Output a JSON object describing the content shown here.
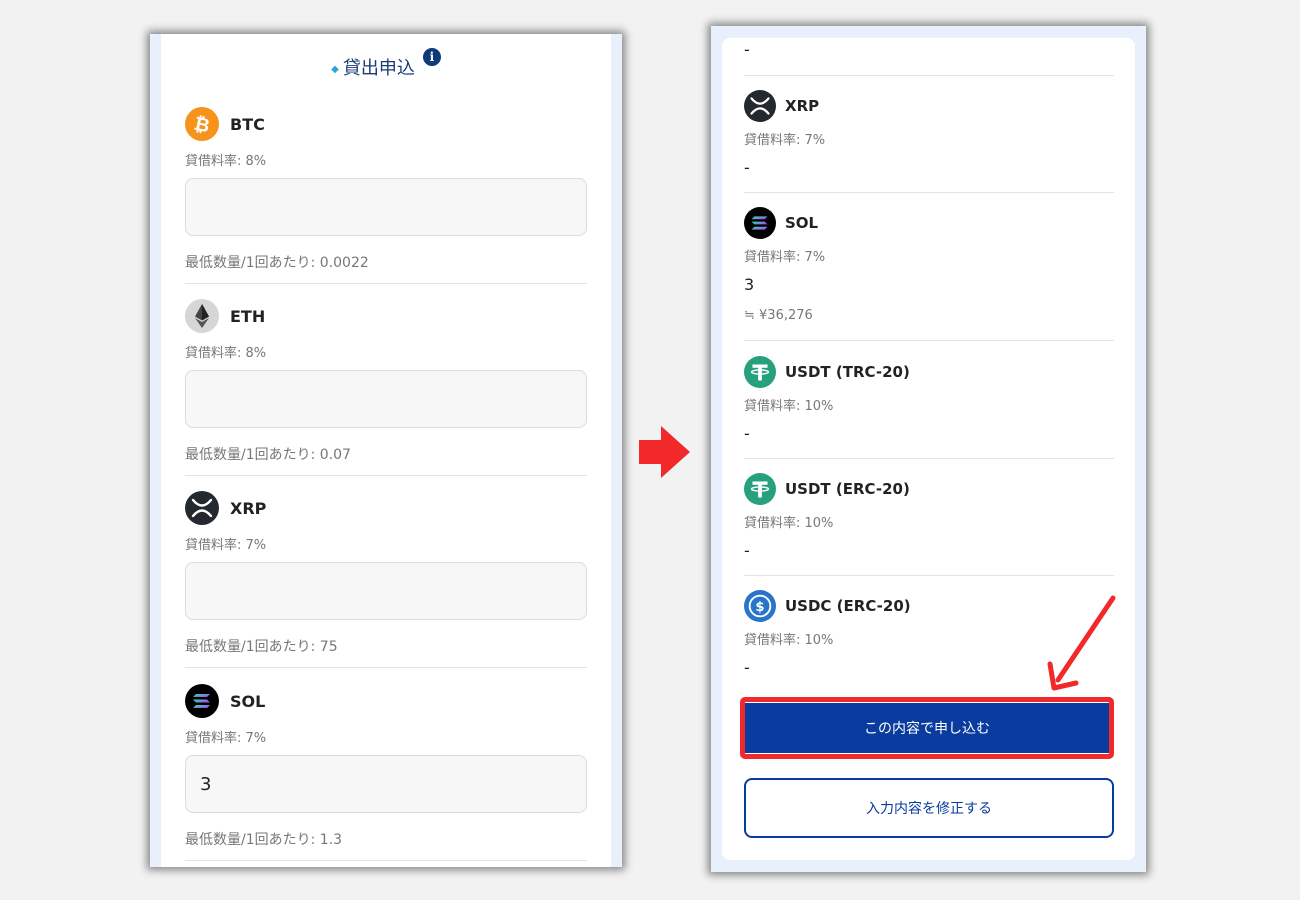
{
  "left_screen": {
    "title": "貸出申込",
    "title_marker": "◆",
    "info_glyph": "i",
    "items": [
      {
        "symbol": "BTC",
        "rate": "貸借料率: 8%",
        "input_value": "",
        "min_qty": "最低数量/1回あたり: 0.0022",
        "icon": "bitcoin-icon",
        "color": "#f7931a"
      },
      {
        "symbol": "ETH",
        "rate": "貸借料率: 8%",
        "input_value": "",
        "min_qty": "最低数量/1回あたり: 0.07",
        "icon": "ethereum-icon",
        "color": "#d6d6d6"
      },
      {
        "symbol": "XRP",
        "rate": "貸借料率: 7%",
        "input_value": "",
        "min_qty": "最低数量/1回あたり: 75",
        "icon": "xrp-icon",
        "color": "#23292f"
      },
      {
        "symbol": "SOL",
        "rate": "貸借料率: 7%",
        "input_value": "3",
        "min_qty": "最低数量/1回あたり: 1.3",
        "icon": "solana-icon",
        "color": "#000000"
      }
    ]
  },
  "right_screen": {
    "top_value": "-",
    "items": [
      {
        "symbol": "XRP",
        "rate": "貸借料率: 7%",
        "value": "-",
        "icon": "xrp-icon"
      },
      {
        "symbol": "SOL",
        "rate": "貸借料率: 7%",
        "value": "3",
        "approx": "≒ ¥36,276",
        "icon": "solana-icon"
      },
      {
        "symbol": "USDT (TRC-20)",
        "rate": "貸借料率: 10%",
        "value": "-",
        "icon": "tether-icon"
      },
      {
        "symbol": "USDT (ERC-20)",
        "rate": "貸借料率: 10%",
        "value": "-",
        "icon": "tether-icon"
      },
      {
        "symbol": "USDC (ERC-20)",
        "rate": "貸借料率: 10%",
        "value": "-",
        "icon": "usdc-icon"
      }
    ],
    "submit_label": "この内容で申し込む",
    "edit_label": "入力内容を修正する"
  },
  "colors": {
    "accent_red": "#f2292b",
    "primary_blue": "#0a3b9f",
    "tether_green": "#26a17b",
    "usdc_blue": "#2775ca"
  }
}
